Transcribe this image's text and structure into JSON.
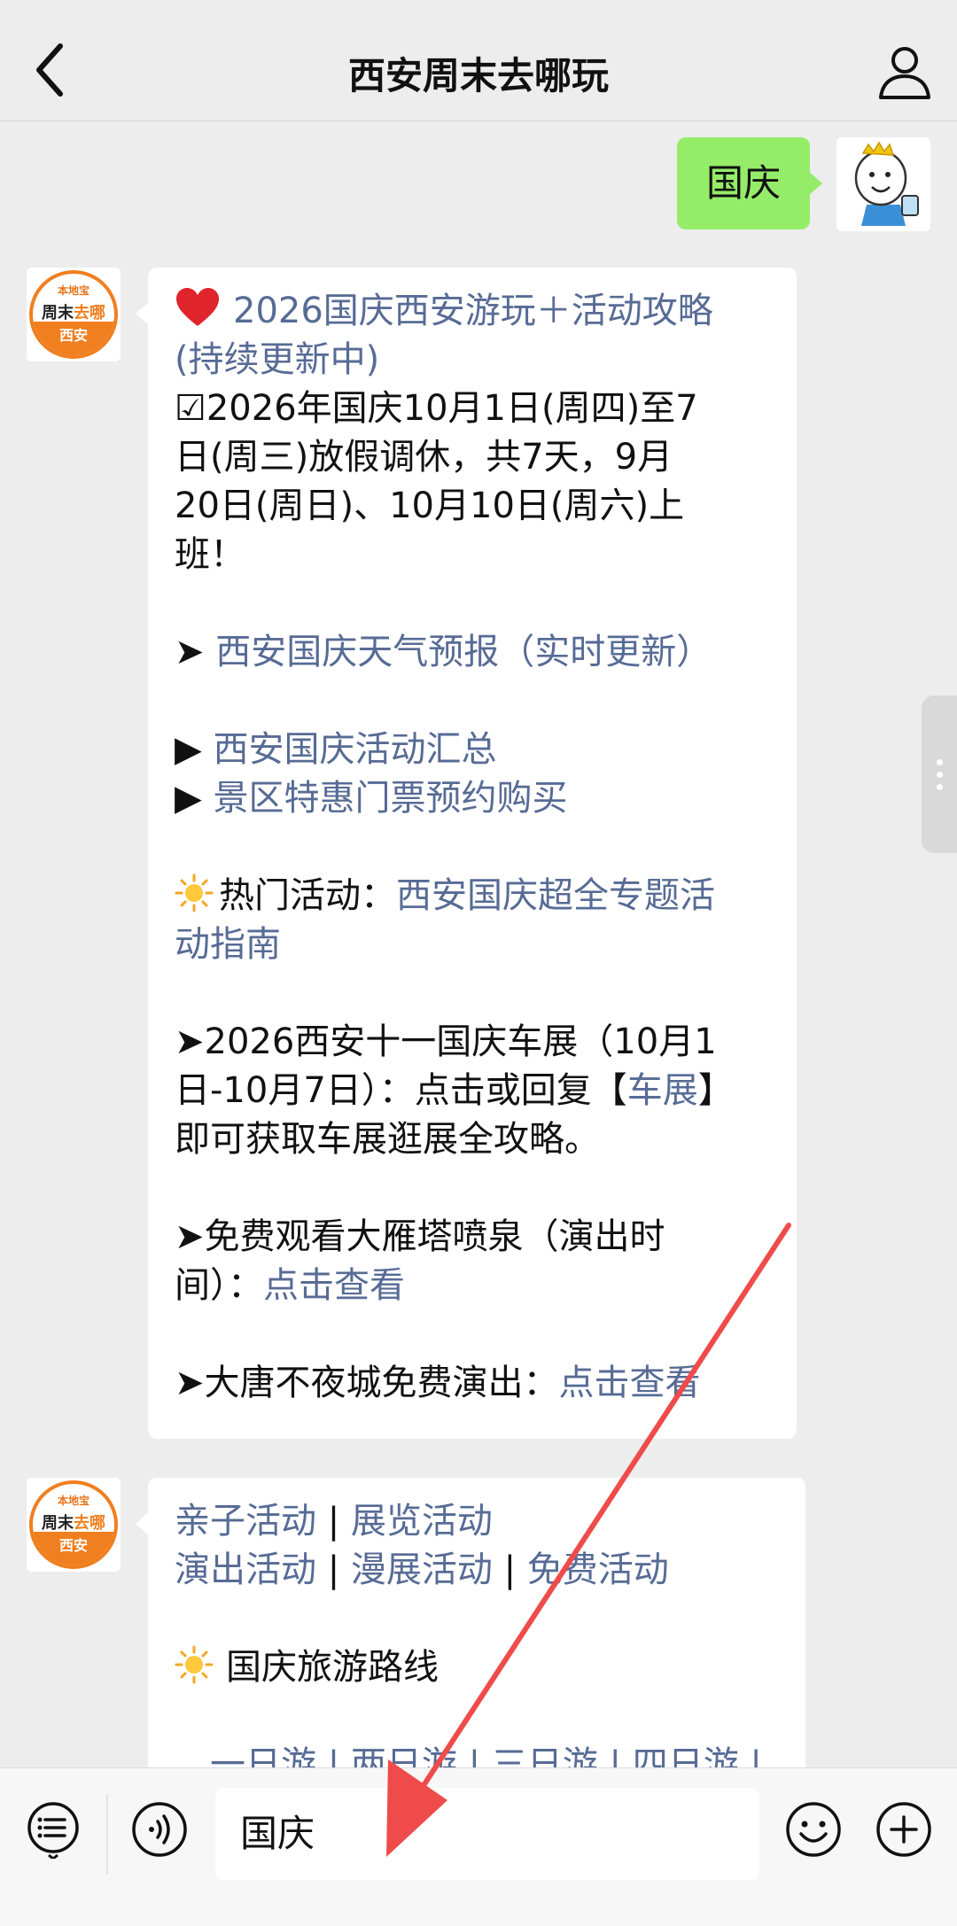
{
  "header": {
    "title": "西安周末去哪玩"
  },
  "outgoing": {
    "text": "国庆"
  },
  "bot_avatar": {
    "brand_top": "本地宝",
    "brand_main_a": "周末",
    "brand_main_b": "去哪",
    "city": "西安"
  },
  "message1": {
    "title_line1": "2026国庆西安游玩＋活动攻略",
    "title_line2": "(持续更新中)",
    "holiday_line1": "☑2026年国庆10月1日(周四)至7",
    "holiday_line2": "日(周三)放假调休，共7天，9月",
    "holiday_line3": "20日(周日)、10月10日(周六)上",
    "holiday_line4": "班！",
    "weather_prefix": "➤ ",
    "weather_link": "西安国庆天气预报（实时更新）",
    "events_prefix": "▶ ",
    "events_link": "西安国庆活动汇总",
    "tickets_prefix": "▶ ",
    "tickets_link": "景区特惠门票预约购买",
    "hot_label": "热门活动：",
    "hot_link_line1": "西安国庆超全专题活",
    "hot_link_line2": "动指南",
    "auto_line1": "➤2026西安十一国庆车展（10月1",
    "auto_line2_a": "日-10月7日）：点击或回复【",
    "auto_line2_link": "车展",
    "auto_line2_b": "】",
    "auto_line3": "即可获取车展逛展全攻略。",
    "fountain_line1": "➤免费观看大雁塔喷泉（演出时",
    "fountain_line2_a": "间）：",
    "fountain_link": "点击查看",
    "tang_text": "➤大唐不夜城免费演出：",
    "tang_link": "点击查看"
  },
  "message2": {
    "cat1": "亲子活动",
    "sep": " | ",
    "cat2": "展览活动",
    "cat3": "演出活动",
    "cat4": "漫展活动",
    "cat5": "免费活动",
    "route_label": "国庆旅游路线",
    "route_partial": "一日游 | 两日游 | 三日游 | 四日游 |"
  },
  "input_bar": {
    "value": "国庆"
  },
  "colors": {
    "link": "#576b95",
    "outgoing_bubble": "#95ec69",
    "brand": "#f07f1f",
    "arrow": "#ef4b4b"
  }
}
